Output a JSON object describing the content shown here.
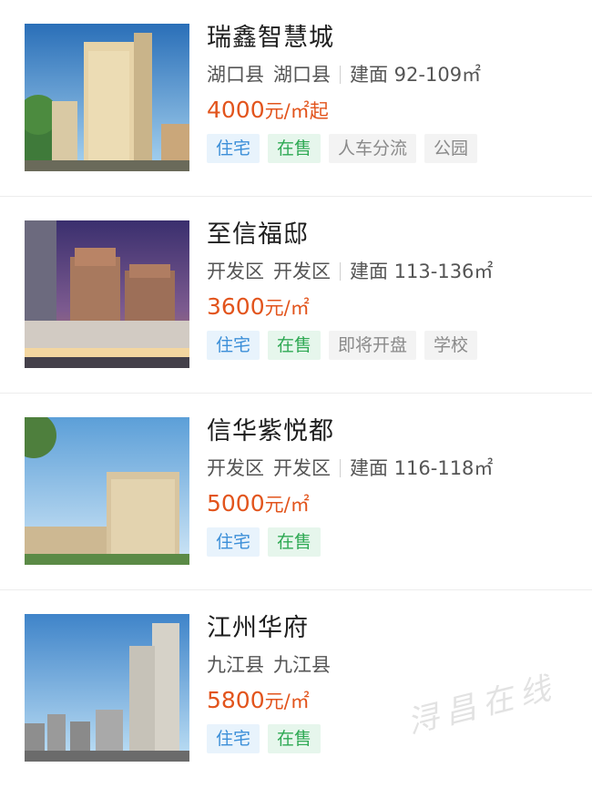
{
  "listings": [
    {
      "name": "瑞鑫智慧城",
      "district": "湖口县",
      "area": "湖口县",
      "building_area": "建面 92-109㎡",
      "price_value": "4000",
      "price_unit": "元/㎡起",
      "tags": [
        {
          "label": "住宅",
          "style": "blue"
        },
        {
          "label": "在售",
          "style": "green"
        },
        {
          "label": "人车分流",
          "style": "gray"
        },
        {
          "label": "公园",
          "style": "gray"
        }
      ]
    },
    {
      "name": "至信福邸",
      "district": "开发区",
      "area": "开发区",
      "building_area": "建面 113-136㎡",
      "price_value": "3600",
      "price_unit": "元/㎡",
      "tags": [
        {
          "label": "住宅",
          "style": "blue"
        },
        {
          "label": "在售",
          "style": "green"
        },
        {
          "label": "即将开盘",
          "style": "gray"
        },
        {
          "label": "学校",
          "style": "gray"
        }
      ]
    },
    {
      "name": "信华紫悦都",
      "district": "开发区",
      "area": "开发区",
      "building_area": "建面 116-118㎡",
      "price_value": "5000",
      "price_unit": "元/㎡",
      "tags": [
        {
          "label": "住宅",
          "style": "blue"
        },
        {
          "label": "在售",
          "style": "green"
        }
      ]
    },
    {
      "name": "江州华府",
      "district": "九江县",
      "area": "九江县",
      "building_area": "",
      "price_value": "5800",
      "price_unit": "元/㎡",
      "tags": [
        {
          "label": "住宅",
          "style": "blue"
        },
        {
          "label": "在售",
          "style": "green"
        }
      ]
    }
  ],
  "watermark": "浔昌在线",
  "colors": {
    "price": "#e2541c",
    "tag_blue": "#3c8fd8",
    "tag_green": "#2fa954",
    "tag_gray": "#8a8a8a"
  }
}
